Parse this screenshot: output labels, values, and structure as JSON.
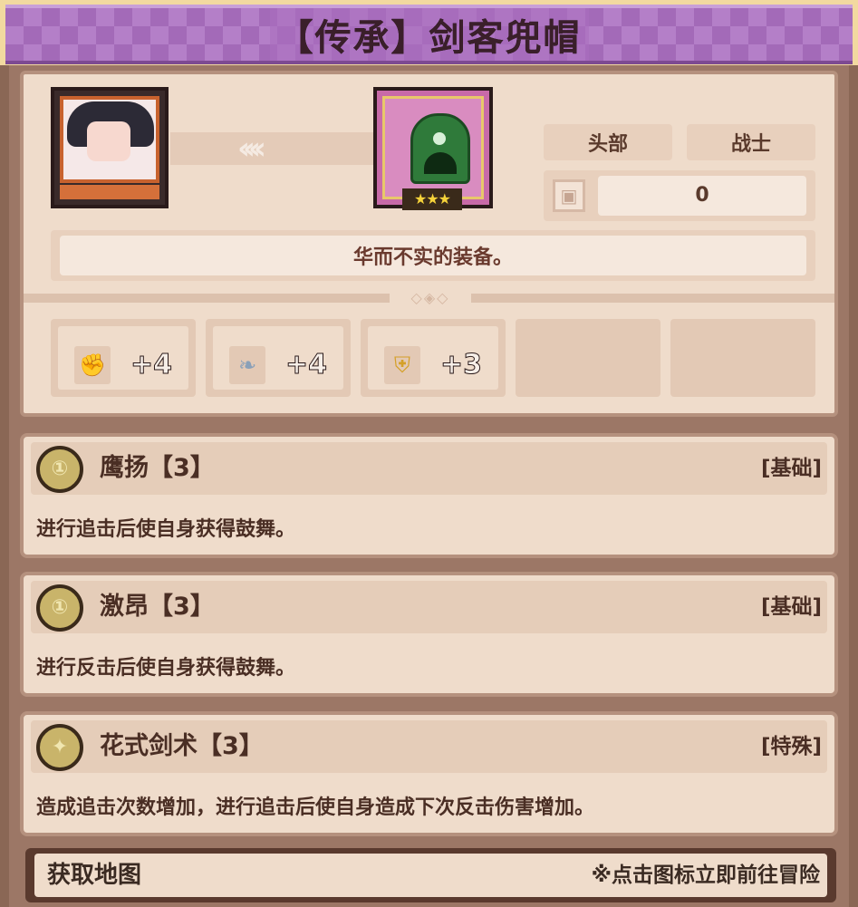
{
  "title": "【传承】剑客兜帽",
  "equipment": {
    "slot": "头部",
    "class": "战士",
    "level_value": "0",
    "stars": "★★★",
    "description": "华而不实的装备。"
  },
  "stats": [
    {
      "icon": "fist-icon",
      "value": "+4"
    },
    {
      "icon": "feather-icon",
      "value": "+4"
    },
    {
      "icon": "shield-icon",
      "value": "+3"
    }
  ],
  "skills": [
    {
      "name": "鹰扬【3】",
      "type": "[基础]",
      "description": "进行追击后使自身获得鼓舞。",
      "badge": "coin-badge-icon"
    },
    {
      "name": "激昂【3】",
      "type": "[基础]",
      "description": "进行反击后使自身获得鼓舞。",
      "badge": "coin-badge-icon"
    },
    {
      "name": "花式剑术【3】",
      "type": "[特殊]",
      "description": "造成追击次数增加，进行追击后使自身造成下次反击伤害增加。",
      "badge": "coin-badge-icon"
    }
  ],
  "footer": {
    "title": "获取地图",
    "hint": "※点击图标立即前往冒险"
  },
  "colors": {
    "banner": "#a36ab8",
    "panel": "#efdccb",
    "border": "#b5917e",
    "text": "#4a2e24"
  }
}
